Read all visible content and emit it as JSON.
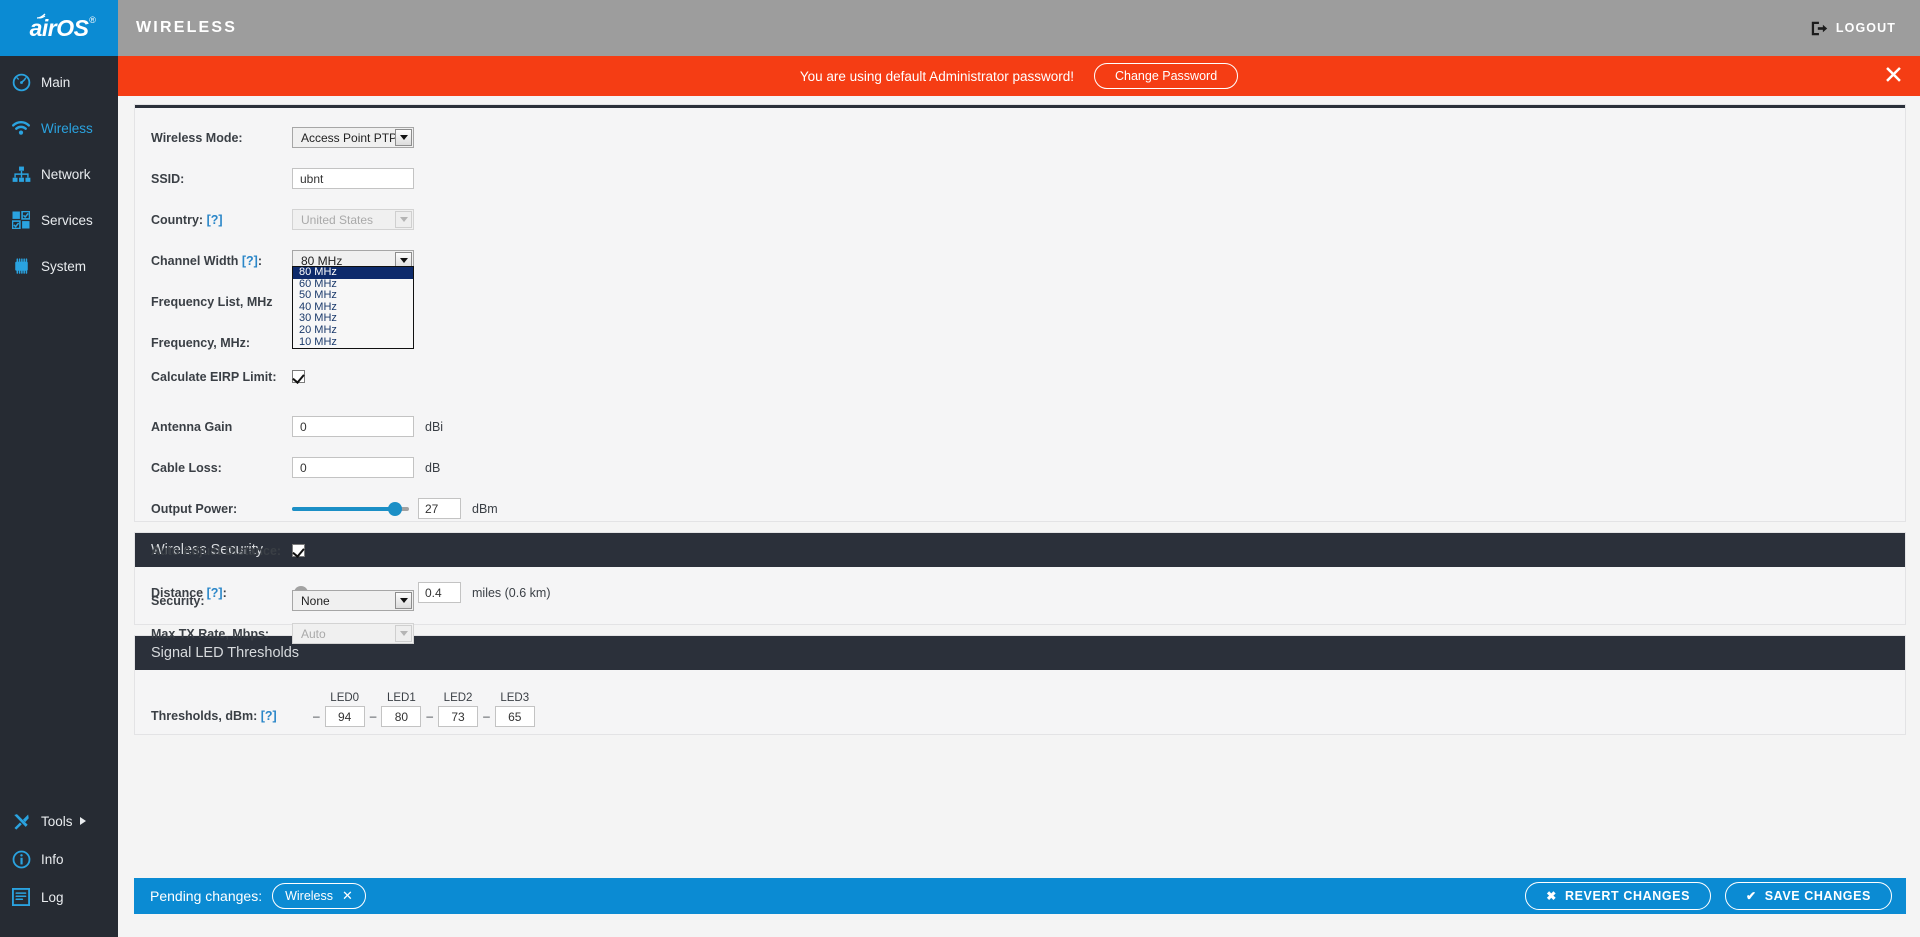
{
  "brand": {
    "name": "airOS",
    "registered": "®"
  },
  "header": {
    "title": "WIRELESS",
    "logout_label": "LOGOUT",
    "logout_icon": "logout-icon"
  },
  "alert": {
    "message": "You are using default Administrator password!",
    "button_label": "Change Password",
    "close_icon": "close-icon",
    "color": "#f53d14"
  },
  "sidebar": {
    "items": [
      {
        "label": "Main",
        "icon": "gauge-icon",
        "active": false
      },
      {
        "label": "Wireless",
        "icon": "wifi-icon",
        "active": true
      },
      {
        "label": "Network",
        "icon": "network-icon",
        "active": false
      },
      {
        "label": "Services",
        "icon": "services-icon",
        "active": false
      },
      {
        "label": "System",
        "icon": "system-icon",
        "active": false
      }
    ],
    "bottom_items": [
      {
        "label": "Tools",
        "icon": "tools-icon",
        "has_caret": true
      },
      {
        "label": "Info",
        "icon": "info-icon",
        "has_caret": false
      },
      {
        "label": "Log",
        "icon": "log-icon",
        "has_caret": false
      }
    ],
    "accent": "#2aa3e0"
  },
  "basic": {
    "wireless_mode": {
      "label": "Wireless Mode:",
      "value": "Access Point PTP"
    },
    "ssid": {
      "label": "SSID:",
      "value": "ubnt"
    },
    "country": {
      "label": "Country:",
      "hint": "[?]",
      "value": "United States",
      "disabled": true
    },
    "channel_width": {
      "label": "Channel Width",
      "hint": "[?]",
      "suffix": ":",
      "value": "80 MHz",
      "open": true,
      "options": [
        "80 MHz",
        "60 MHz",
        "50 MHz",
        "40 MHz",
        "30 MHz",
        "20 MHz",
        "10 MHz"
      ],
      "selected_index": 0
    },
    "frequency_list": {
      "label": "Frequency List, MHz"
    },
    "frequency": {
      "label": "Frequency, MHz:"
    },
    "calculate_eirp": {
      "label": "Calculate EIRP Limit:",
      "checked": true
    },
    "antenna_gain": {
      "label": "Antenna Gain",
      "value": "0",
      "unit": "dBi"
    },
    "cable_loss": {
      "label": "Cable Loss:",
      "value": "0",
      "unit": "dB"
    },
    "output_power": {
      "label": "Output Power:",
      "value": "27",
      "unit": "dBm",
      "percent": 93
    },
    "auto_adjust_distance": {
      "label": "Auto Adjust Distance:",
      "checked": true
    },
    "distance": {
      "label": "Distance",
      "hint": "[?]",
      "suffix": ":",
      "value": "0.4",
      "unit": "miles (0.6 km)",
      "percent": 2
    },
    "max_tx_rate": {
      "label": "Max TX Rate, Mbps:",
      "value": "Auto",
      "disabled": true
    }
  },
  "security": {
    "panel_title": "Wireless Security",
    "security": {
      "label": "Security:",
      "value": "None"
    }
  },
  "led": {
    "panel_title": "Signal LED Thresholds",
    "row_label": "Thresholds, dBm:",
    "hint": "[?]",
    "dash": "–",
    "items": [
      {
        "caption": "LED0",
        "value": "94"
      },
      {
        "caption": "LED1",
        "value": "80"
      },
      {
        "caption": "LED2",
        "value": "73"
      },
      {
        "caption": "LED3",
        "value": "65"
      }
    ]
  },
  "pending": {
    "label": "Pending changes:",
    "chip": "Wireless",
    "chip_close": "✕",
    "revert_label": "REVERT CHANGES",
    "revert_icon": "✖",
    "save_label": "SAVE CHANGES",
    "save_icon": "✔",
    "color": "#0b8bd3"
  }
}
